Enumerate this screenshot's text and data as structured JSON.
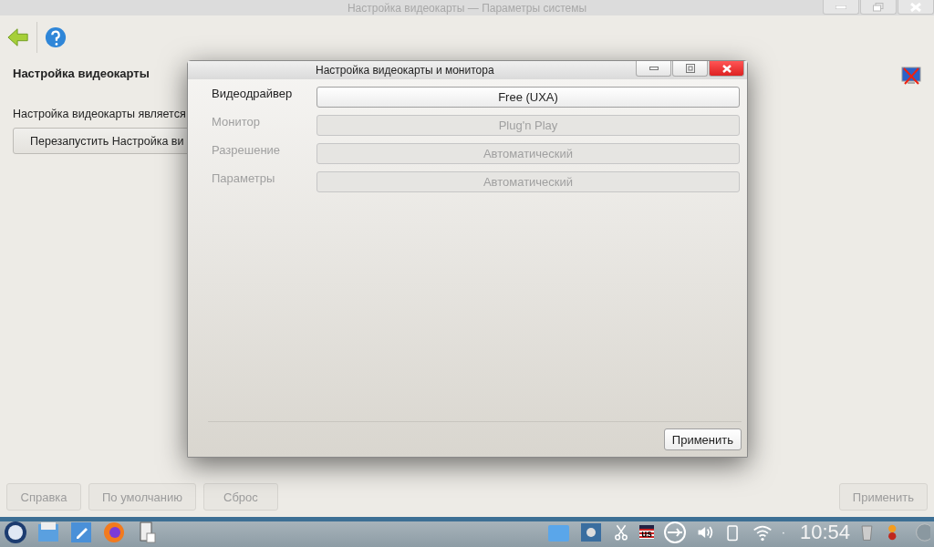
{
  "window": {
    "title": "Настройка видеокарты — Параметры системы"
  },
  "page": {
    "heading": "Настройка видеокарты",
    "description": "Настройка видеокарты является",
    "restart_button": "Перезапустить Настройка ви"
  },
  "footer": {
    "buttons": [
      {
        "label": "Справка",
        "disabled": true
      },
      {
        "label": "По умолчанию",
        "disabled": true
      },
      {
        "label": "Сброс",
        "disabled": true
      }
    ],
    "apply": {
      "label": "Применить",
      "disabled": true
    }
  },
  "dialog": {
    "title": "Настройка видеокарты и монитора",
    "rows": [
      {
        "label": "Видеодрайвер",
        "value": "Free (UXA)",
        "disabled": false
      },
      {
        "label": "Монитор",
        "value": "Plug'n Play",
        "disabled": true
      },
      {
        "label": "Разрешение",
        "value": "Автоматический",
        "disabled": true
      },
      {
        "label": "Параметры",
        "value": "Автоматический",
        "disabled": true
      }
    ],
    "apply": "Применить"
  },
  "taskbar": {
    "keyboard_layout": "us",
    "clock": "10:54"
  }
}
